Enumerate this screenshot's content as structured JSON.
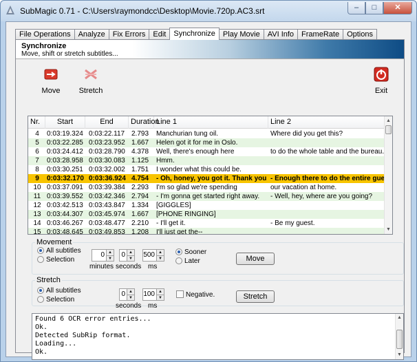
{
  "window": {
    "title": "SubMagic 0.71 - C:\\Users\\raymondcc\\Desktop\\Movie.720p.AC3.srt",
    "controls": {
      "minimize": "–",
      "maximize": "□",
      "close": "✕"
    }
  },
  "tabs": [
    "File Operations",
    "Analyze",
    "Fix Errors",
    "Edit",
    "Synchronize",
    "Play Movie",
    "AVI Info",
    "FrameRate",
    "Options"
  ],
  "active_tab": "Synchronize",
  "banner": {
    "title": "Synchronize",
    "subtitle": "Move, shift or stretch subtitles..."
  },
  "toolbar": {
    "move_label": "Move",
    "stretch_label": "Stretch",
    "exit_label": "Exit"
  },
  "grid": {
    "columns": [
      "Nr.",
      "Start",
      "End",
      "Duration",
      "Line 1",
      "Line 2"
    ],
    "rows": [
      [
        "4",
        "0:03:19.324",
        "0:03:22.117",
        "2.793",
        "Manchurian tung oil.",
        "Where did you get this?"
      ],
      [
        "5",
        "0:03:22.285",
        "0:03:23.952",
        "1.667",
        "Helen got it for me in Oslo.",
        ""
      ],
      [
        "6",
        "0:03:24.412",
        "0:03:28.790",
        "4.378",
        "Well, there's enough here",
        "to do the whole table and the bureau."
      ],
      [
        "7",
        "0:03:28.958",
        "0:03:30.083",
        "1.125",
        "Hmm.",
        ""
      ],
      [
        "8",
        "0:03:30.251",
        "0:03:32.002",
        "1.751",
        "I wonder what this could be.",
        ""
      ],
      [
        "9",
        "0:03:32.170",
        "0:03:36.924",
        "4.754",
        "- Oh, honey, you got it. Thank you.",
        "- Enough there to do the entire guest ..."
      ],
      [
        "10",
        "0:03:37.091",
        "0:03:39.384",
        "2.293",
        "I'm so glad we're spending",
        "our vacation at home."
      ],
      [
        "11",
        "0:03:39.552",
        "0:03:42.346",
        "2.794",
        "- I'm gonna get started right away.",
        "- Well, hey, where are you going?"
      ],
      [
        "12",
        "0:03:42.513",
        "0:03:43.847",
        "1.334",
        "[GIGGLES]",
        ""
      ],
      [
        "13",
        "0:03:44.307",
        "0:03:45.974",
        "1.667",
        "[PHONE RINGING]",
        ""
      ],
      [
        "14",
        "0:03:46.267",
        "0:03:48.477",
        "2.210",
        "- I'll get it.",
        "- Be my guest."
      ],
      [
        "15",
        "0:03:48.645",
        "0:03:49.853",
        "1.208",
        "I'll just get the--",
        ""
      ]
    ],
    "selected_nr": "9"
  },
  "movement": {
    "group_label": "Movement",
    "all_subtitles": "All subtitles",
    "selection": "Selection",
    "minutes_value": "0",
    "seconds_value": "0",
    "ms_value": "500",
    "minutes_label": "minutes",
    "seconds_label": "seconds",
    "ms_label": "ms",
    "sooner": "Sooner",
    "later": "Later",
    "button": "Move"
  },
  "stretch": {
    "group_label": "Stretch",
    "all_subtitles": "All subtitles",
    "selection": "Selection",
    "seconds_value": "0",
    "ms_value": "100",
    "seconds_label": "seconds",
    "ms_label": "ms",
    "negative": "Negative.",
    "button": "Stretch"
  },
  "log": [
    "Found 6 OCR error entries...",
    "Ok.",
    "Detected SubRip format.",
    "Loading...",
    "Ok."
  ],
  "colors": {
    "selected_row": "#f8c400",
    "alt_row": "#e6f5e2",
    "exit_red": "#d22b21"
  }
}
